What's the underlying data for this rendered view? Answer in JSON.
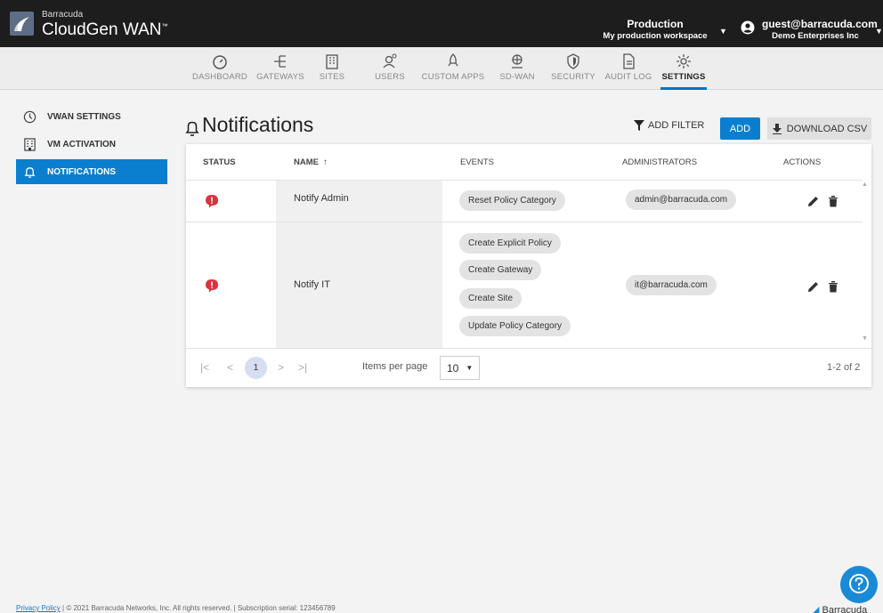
{
  "header": {
    "brand_small": "Barracuda",
    "brand_name": "CloudGen WAN",
    "brand_tm": "™",
    "workspace_title": "Production",
    "workspace_sub": "My production workspace",
    "user_email": "guest@barracuda.com",
    "user_org": "Demo Enterprises Inc"
  },
  "nav": [
    {
      "label": "DASHBOARD",
      "icon": "dashboard-icon"
    },
    {
      "label": "GATEWAYS",
      "icon": "gateways-icon"
    },
    {
      "label": "SITES",
      "icon": "sites-icon"
    },
    {
      "label": "USERS",
      "icon": "users-icon"
    },
    {
      "label": "CUSTOM APPS",
      "icon": "custom-apps-icon"
    },
    {
      "label": "SD-WAN",
      "icon": "sd-wan-icon"
    },
    {
      "label": "SECURITY",
      "icon": "security-icon"
    },
    {
      "label": "AUDIT LOG",
      "icon": "audit-log-icon"
    },
    {
      "label": "SETTINGS",
      "icon": "settings-icon",
      "active": true
    }
  ],
  "sidebar": [
    {
      "label": "VWAN SETTINGS",
      "icon": "clock-icon"
    },
    {
      "label": "VM ACTIVATION",
      "icon": "building-icon"
    },
    {
      "label": "NOTIFICATIONS",
      "icon": "bell-icon",
      "active": true
    }
  ],
  "page": {
    "title": "Notifications",
    "add_filter": "ADD FILTER",
    "add": "ADD",
    "download_csv": "DOWNLOAD CSV"
  },
  "table": {
    "headers": {
      "status": "STATUS",
      "name": "NAME",
      "name_sort": "↑",
      "events": "EVENTS",
      "admins": "ADMINISTRATORS",
      "actions": "ACTIONS"
    },
    "rows": [
      {
        "name": "Notify Admin",
        "events": [
          "Reset Policy Category"
        ],
        "admin": "admin@barracuda.com"
      },
      {
        "name": "Notify IT",
        "events": [
          "Create Explicit Policy",
          "Create Gateway",
          "Create Site",
          "Update Policy Category"
        ],
        "admin": "it@barracuda.com"
      }
    ]
  },
  "pager": {
    "first": "|<",
    "prev": "<",
    "current": "1",
    "next": ">",
    "last": ">|",
    "items_per_page_label": "Items per page",
    "items_per_page": "10",
    "range": "1-2 of 2"
  },
  "footer": {
    "privacy": "Privacy Policy",
    "text": " | © 2021 Barracuda Networks, Inc. All rights reserved. | Subscription serial: 123456789"
  },
  "corner_logo": "Barracuda",
  "colors": {
    "accent": "#0a7fcf",
    "status_error": "#d9333f",
    "topbar": "#1d1d1d"
  }
}
